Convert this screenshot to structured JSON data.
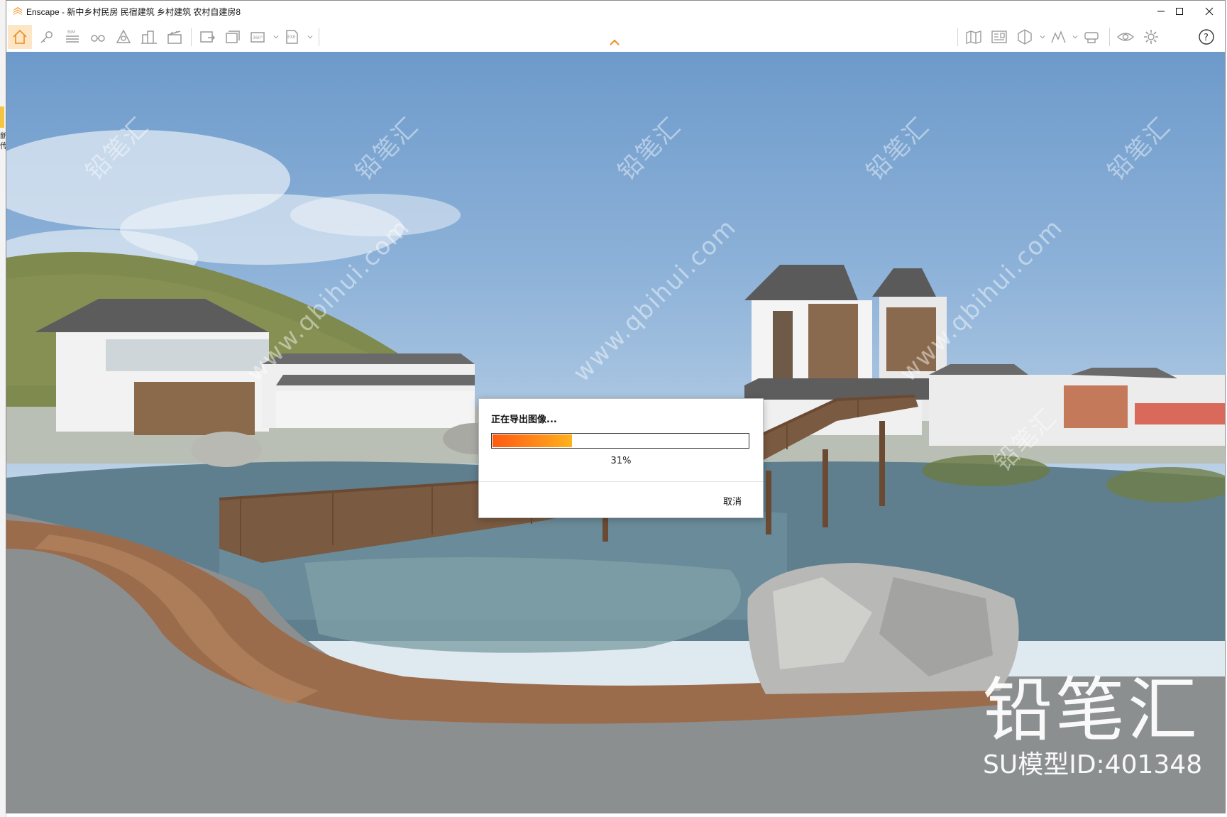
{
  "window": {
    "app_name": "Enscape",
    "title": "Enscape - 新中乡村民房 民宿建筑 乡村建筑 农村自建房8",
    "minimize_icon": "minimize-icon",
    "maximize_icon": "maximize-icon",
    "close_icon": "close-icon"
  },
  "background_app": {
    "side_text": "新\n传"
  },
  "toolbar": {
    "left_tools": [
      "home-icon",
      "assets-icon",
      "bim-icon",
      "views-icon",
      "settings-camera-icon",
      "buildings-icon",
      "video-editor-icon",
      "screenshot-icon",
      "batch-render-icon",
      "panorama-icon",
      "export-exe-icon"
    ],
    "bim_label": "BIM",
    "panorama_label": "360°",
    "exe_label": "EXE",
    "right_tools": [
      "map-icon",
      "material-editor-icon",
      "section-icon",
      "sun-graph-icon",
      "vr-headset-icon",
      "eye-icon",
      "gear-icon",
      "help-icon"
    ],
    "help_label": "?",
    "accent": "#f08a1c"
  },
  "dialog": {
    "title": "正在导出图像...",
    "progress": 0.31,
    "percent_label": "31%",
    "cancel_label": "取消"
  },
  "watermark": {
    "brand": "铅笔汇",
    "model_id": "SU模型ID:401348",
    "url": "www.qbihui.com"
  }
}
